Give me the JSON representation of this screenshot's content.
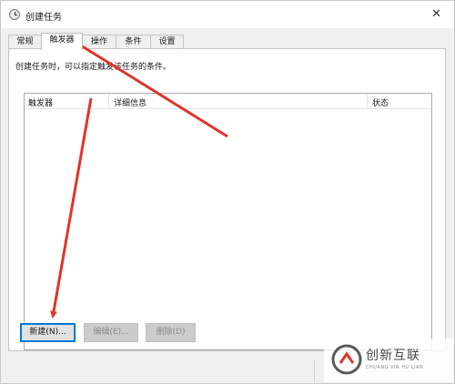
{
  "window": {
    "title": "创建任务",
    "close_glyph": "✕"
  },
  "tabs": [
    {
      "label": "常规",
      "active": false
    },
    {
      "label": "触发器",
      "active": true
    },
    {
      "label": "操作",
      "active": false
    },
    {
      "label": "条件",
      "active": false
    },
    {
      "label": "设置",
      "active": false
    }
  ],
  "panel": {
    "hint": "创建任务时，可以指定触发该任务的条件。",
    "columns": [
      "触发器",
      "详细信息",
      "状态"
    ]
  },
  "buttons": {
    "new": "新建(N)...",
    "edit": "编辑(E)...",
    "delete": "删除(D)"
  },
  "watermark": {
    "text_cn": "创新互联",
    "text_en": "CHUANG XIN HU LIAN"
  },
  "colors": {
    "annotation_arrow": "#e0342a",
    "focus_border": "#0078d7"
  },
  "icons": [
    "clock-icon",
    "close-icon",
    "watermark-logo-icon"
  ]
}
